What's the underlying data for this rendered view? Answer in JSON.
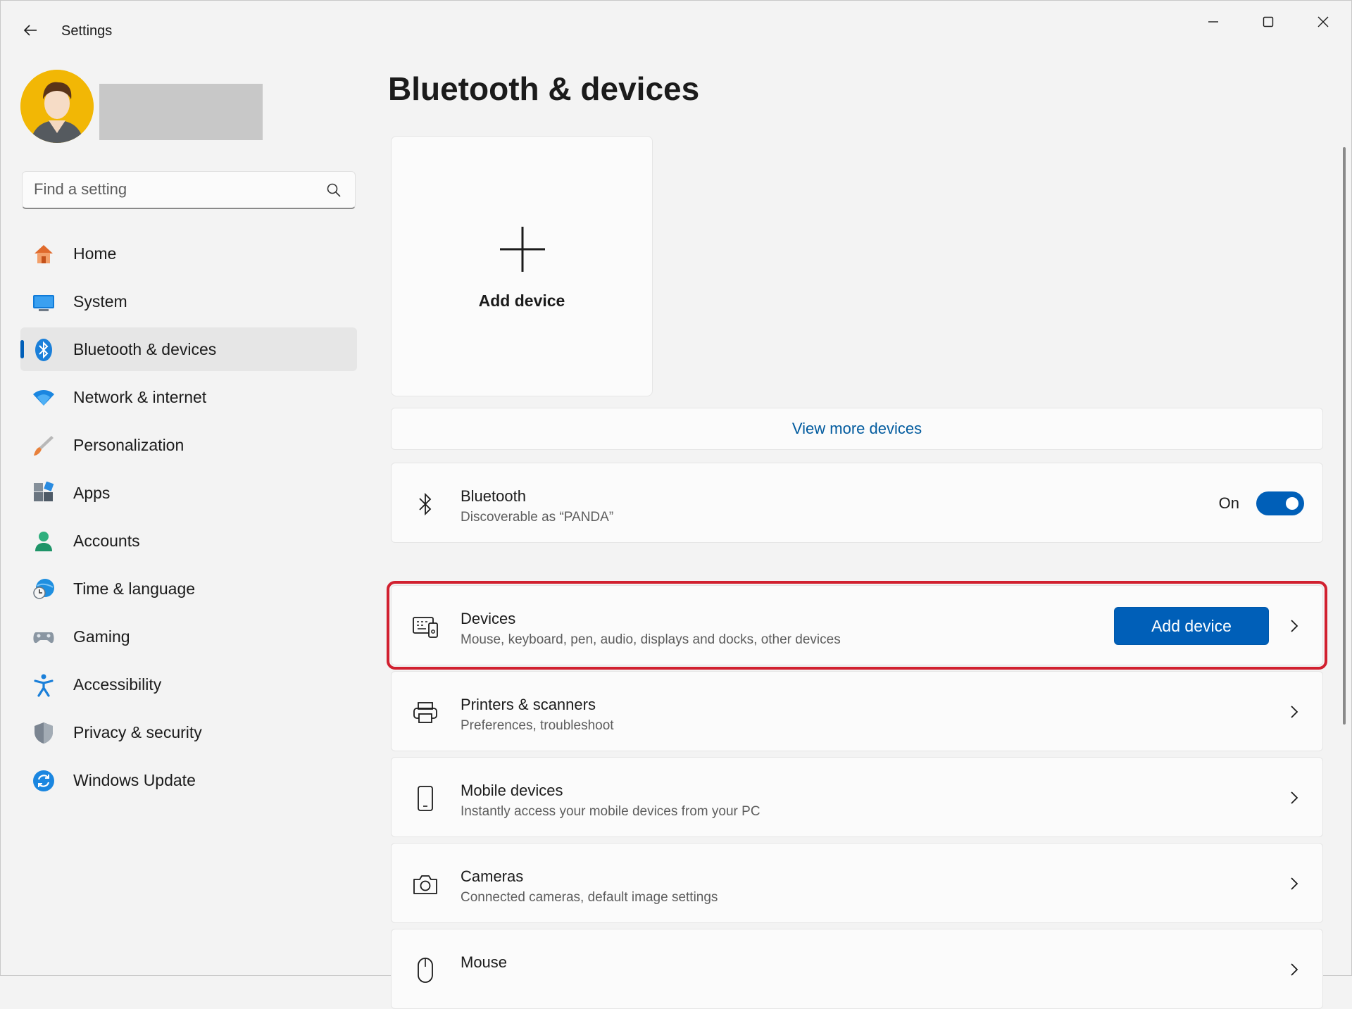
{
  "window": {
    "title": "Settings"
  },
  "search": {
    "placeholder": "Find a setting"
  },
  "sidebar": {
    "items": [
      {
        "label": "Home",
        "icon": "home-icon"
      },
      {
        "label": "System",
        "icon": "system-icon"
      },
      {
        "label": "Bluetooth & devices",
        "icon": "bluetooth-icon",
        "active": true
      },
      {
        "label": "Network & internet",
        "icon": "wifi-icon"
      },
      {
        "label": "Personalization",
        "icon": "brush-icon"
      },
      {
        "label": "Apps",
        "icon": "apps-icon"
      },
      {
        "label": "Accounts",
        "icon": "person-icon"
      },
      {
        "label": "Time & language",
        "icon": "globe-clock-icon"
      },
      {
        "label": "Gaming",
        "icon": "gamepad-icon"
      },
      {
        "label": "Accessibility",
        "icon": "accessibility-icon"
      },
      {
        "label": "Privacy & security",
        "icon": "shield-icon"
      },
      {
        "label": "Windows Update",
        "icon": "update-icon"
      }
    ]
  },
  "main": {
    "title": "Bluetooth & devices",
    "add_tile_label": "Add device",
    "view_more_label": "View more devices",
    "bluetooth": {
      "title": "Bluetooth",
      "subtitle": "Discoverable as “PANDA”",
      "state_label": "On",
      "enabled": true
    },
    "cards": [
      {
        "title": "Devices",
        "subtitle": "Mouse, keyboard, pen, audio, displays and docks, other devices",
        "button": "Add device",
        "highlighted": true,
        "icon": "devices-icon"
      },
      {
        "title": "Printers & scanners",
        "subtitle": "Preferences, troubleshoot",
        "icon": "printer-icon"
      },
      {
        "title": "Mobile devices",
        "subtitle": "Instantly access your mobile devices from your PC",
        "icon": "phone-icon"
      },
      {
        "title": "Cameras",
        "subtitle": "Connected cameras, default image settings",
        "icon": "camera-icon"
      },
      {
        "title": "Mouse",
        "subtitle": "",
        "icon": "mouse-icon"
      }
    ]
  },
  "colors": {
    "accent": "#005fb8",
    "highlight_border": "#d1202f",
    "link": "#005a9e"
  }
}
